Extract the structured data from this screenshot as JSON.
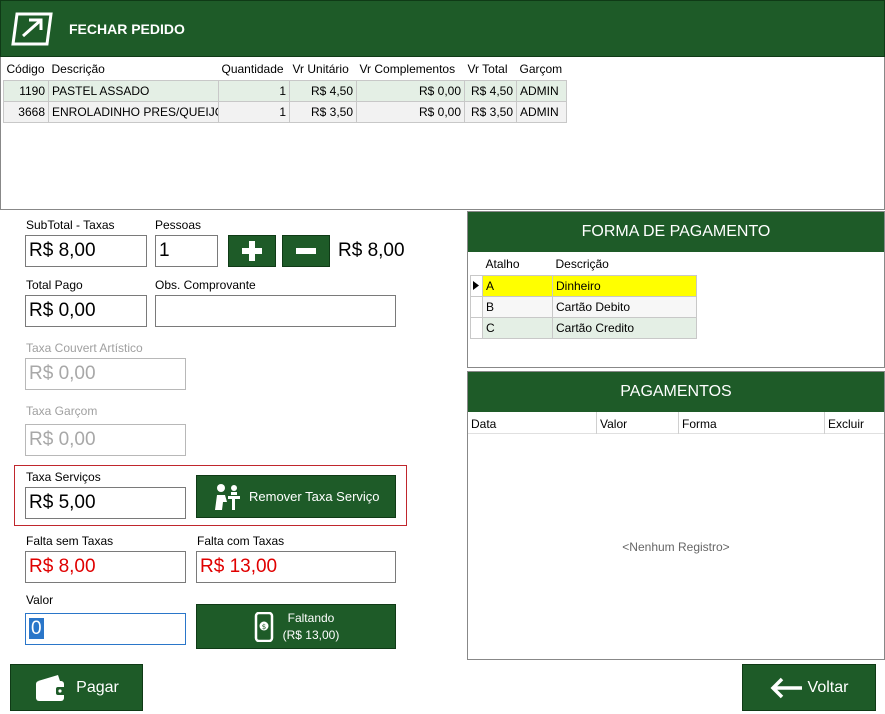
{
  "header": {
    "title": "FECHAR PEDIDO",
    "logo_icon": "arrow-box-icon"
  },
  "items_table": {
    "columns": [
      "Código",
      "Descrição",
      "Quantidade",
      "Vr Unitário",
      "Vr Complementos",
      "Vr Total",
      "Garçom"
    ],
    "rows": [
      [
        "1190",
        "PASTEL ASSADO",
        "1",
        "R$ 4,50",
        "R$ 0,00",
        "R$ 4,50",
        "ADMIN"
      ],
      [
        "3668",
        "ENROLADINHO PRES/QUEIJO",
        "1",
        "R$ 3,50",
        "R$ 0,00",
        "R$ 3,50",
        "ADMIN"
      ]
    ]
  },
  "form": {
    "subtotal_label": "SubTotal - Taxas",
    "subtotal_value": "R$ 8,00",
    "pessoas_label": "Pessoas",
    "pessoas_value": "1",
    "per_person_value": "R$ 8,00",
    "total_pago_label": "Total Pago",
    "total_pago_value": "R$ 0,00",
    "obs_label": "Obs. Comprovante",
    "obs_value": "",
    "couvert_label": "Taxa Couvert Artístico",
    "couvert_value": "R$ 0,00",
    "garcom_label": "Taxa Garçom",
    "garcom_value": "R$ 0,00",
    "servicos_label": "Taxa Serviços",
    "servicos_value": "R$ 5,00",
    "remover_label": "Remover Taxa Serviço",
    "falta_sem_label": "Falta sem Taxas",
    "falta_sem_value": "R$ 8,00",
    "falta_com_label": "Falta com Taxas",
    "falta_com_value": "R$ 13,00",
    "valor_label": "Valor",
    "valor_value": "0",
    "faltando_label": "Faltando",
    "faltando_value": "(R$ 13,00)"
  },
  "forma_pagamento": {
    "title": "FORMA DE PAGAMENTO",
    "columns": [
      "Atalho",
      "Descrição"
    ],
    "rows": [
      {
        "atalho": "A",
        "descricao": "Dinheiro"
      },
      {
        "atalho": "B",
        "descricao": "Cartão Debito"
      },
      {
        "atalho": "C",
        "descricao": "Cartão Credito"
      }
    ]
  },
  "pagamentos": {
    "title": "PAGAMENTOS",
    "columns": [
      "Data",
      "Valor",
      "Forma",
      "Excluir"
    ],
    "empty_text": "<Nenhum Registro>"
  },
  "footer": {
    "pagar_label": "Pagar",
    "voltar_label": "Voltar"
  },
  "colors": {
    "brand_green": "#1e5b28",
    "highlight_yellow": "#ffff00",
    "alert_red": "#e00000"
  }
}
